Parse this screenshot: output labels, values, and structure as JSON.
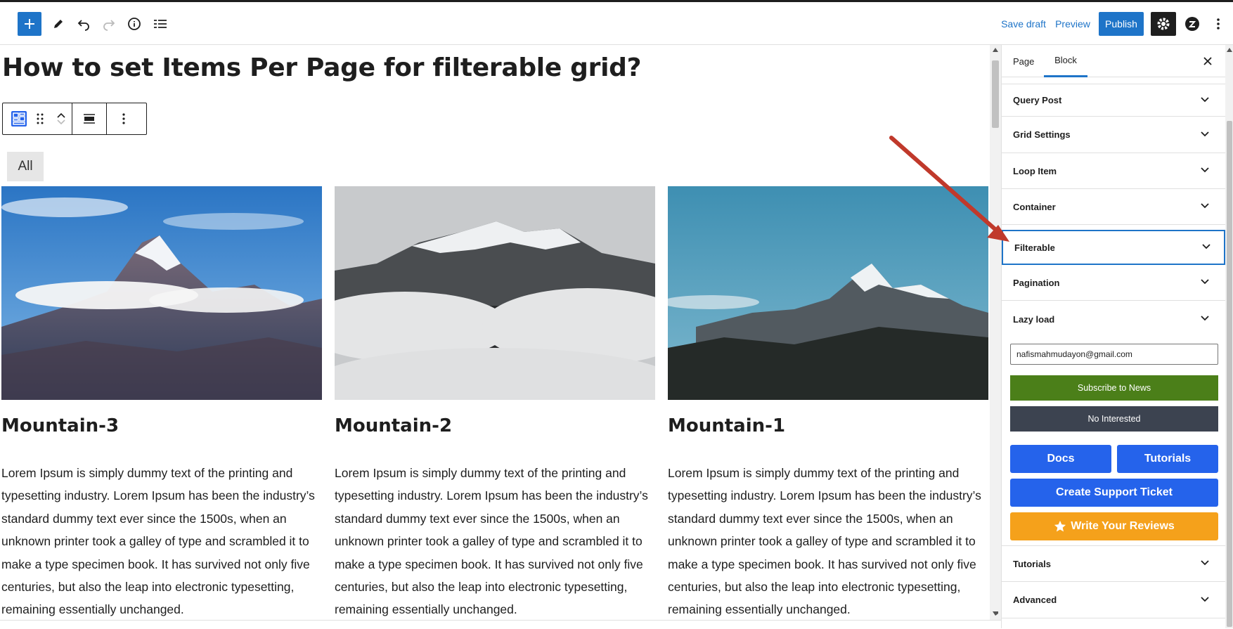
{
  "toolbar": {
    "save_draft": "Save draft",
    "preview": "Preview",
    "publish": "Publish"
  },
  "post": {
    "title": "How to set Items Per Page for filterable grid?"
  },
  "filter": {
    "all_label": "All"
  },
  "cards": [
    {
      "title": "Mountain-3",
      "text": "Lorem Ipsum is simply dummy text of the printing and typesetting industry. Lorem Ipsum has been the industry’s standard dummy text ever since the 1500s, when an unknown printer took a galley of type and scrambled it to make a type specimen book. It has survived not only five centuries, but also the leap into electronic typesetting, remaining essentially unchanged."
    },
    {
      "title": "Mountain-2",
      "text": "Lorem Ipsum is simply dummy text of the printing and typesetting industry. Lorem Ipsum has been the industry’s standard dummy text ever since the 1500s, when an unknown printer took a galley of type and scrambled it to make a type specimen book. It has survived not only five centuries, but also the leap into electronic typesetting, remaining essentially unchanged."
    },
    {
      "title": "Mountain-1",
      "text": "Lorem Ipsum is simply dummy text of the printing and typesetting industry. Lorem Ipsum has been the industry’s standard dummy text ever since the 1500s, when an unknown printer took a galley of type and scrambled it to make a type specimen book. It has survived not only five centuries, but also the leap into electronic typesetting, remaining essentially unchanged."
    }
  ],
  "sidebar": {
    "tabs": [
      "Page",
      "Block"
    ],
    "active_tab": "Block",
    "panels": [
      "Query Post",
      "Grid Settings",
      "Loop Item",
      "Container",
      "Filterable",
      "Pagination",
      "Lazy load"
    ],
    "focused_panel": "Filterable",
    "email_value": "nafismahmudayon@gmail.com",
    "subscribe_label": "Subscribe to News",
    "no_interest_label": "No Interested",
    "docs_label": "Docs",
    "tutorials_label": "Tutorials",
    "support_label": "Create Support Ticket",
    "review_label": "Write Your Reviews",
    "bottom_panels": [
      "Tutorials",
      "Advanced"
    ]
  },
  "colors": {
    "accent": "#1e74c8",
    "subscribe": "#4b7f19",
    "no_interest": "#3c4350",
    "blue_button": "#2563eb",
    "review": "#f5a11b",
    "annotation_arrow": "#c0392b"
  }
}
